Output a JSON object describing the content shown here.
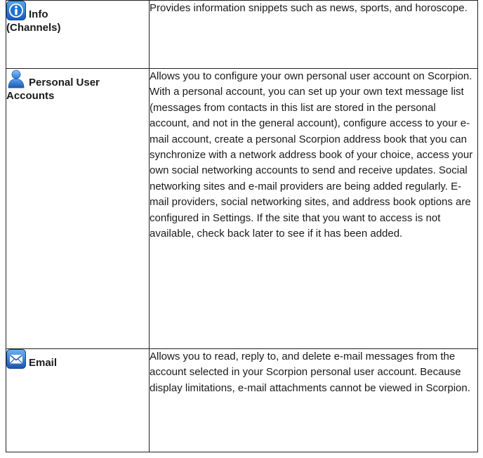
{
  "rows": [
    {
      "icon": "info-icon",
      "name_line1": "Info",
      "name_line2": "(Channels)",
      "description": "Provides information snippets such as news, sports, and horoscope."
    },
    {
      "icon": "user-account-icon",
      "name_line1": "Personal User",
      "name_line2": "Accounts",
      "description": "Allows you to configure your own personal user account on Scorpion. With a personal account, you can set up your own text message list (messages from contacts in this list are stored in the personal account, and not in the general account), configure access to your e-mail account, create a personal Scorpion address book that you can synchronize with a network address book of your choice, access your own social networking accounts to send and receive updates. Social networking sites and e-mail providers are being added regularly. E-mail providers, social networking sites, and address book options are configured in Settings. If the site that you want to access is not available, check back later to see if it has been added."
    },
    {
      "icon": "email-icon",
      "name_line1": "Email",
      "name_line2": "",
      "description": "Allows you to read, reply to, and delete e-mail messages from the account selected in your Scorpion personal user account. Because display limitations, e-mail attachments cannot be viewed in Scorpion."
    }
  ],
  "colors": {
    "border": "#222222",
    "info_icon_blue": "#1e73d2",
    "user_icon_blue": "#2f7fd8",
    "email_icon_blue": "#1f5fbf"
  }
}
